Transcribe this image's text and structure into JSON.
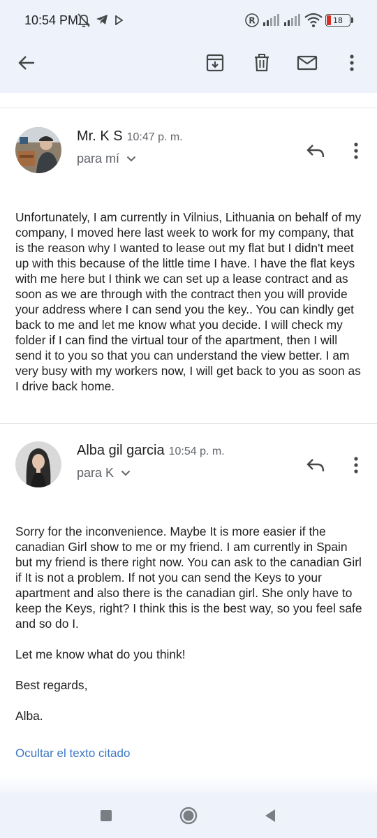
{
  "status_bar": {
    "time": "10:54 PM",
    "battery": "18",
    "icons": [
      "bell-off-icon",
      "telegram-icon",
      "play-icon",
      "registered-icon",
      "signal-icon",
      "wifi-icon",
      "battery-icon"
    ]
  },
  "toolbar": {
    "back": "arrow-back-icon",
    "actions": [
      "archive-icon",
      "delete-icon",
      "mark-unread-icon",
      "more-vert-icon"
    ]
  },
  "thread": {
    "messages": [
      {
        "sender": "Mr. K S",
        "time": "10:47 p. m.",
        "recipient": "para mí",
        "body": [
          "Unfortunately, I am currently in Vilnius, Lithuania on behalf of my company, I moved here last week to work for my company, that is the reason why I wanted to lease out my flat but I didn't meet up with this because of the little time I have. I have the flat keys with me here but I think we can set up a lease contract and as soon as we are through with the contract then you will provide your address where I can send you the key.. You can kindly get back to me and let me know what you decide. I will check my folder if I can find the virtual tour of the apartment, then I will send it to you so that you can understand the view better. I am very busy with my workers now, I will get back to you as soon as I drive back home."
        ]
      },
      {
        "sender": "Alba gil garcia",
        "time": "10:54 p. m.",
        "recipient": "para K",
        "body": [
          "Sorry for the inconvenience. Maybe It is more easier if the canadian Girl show to me or my friend. I am currently in Spain but my friend is there right now. You can ask to the canadian Girl if It is not a problem. If not you can send the Keys to your apartment and also there is the canadian girl. She only have to keep the Keys, right? I think this is the best way, so you feel safe and so do I.",
          "Let me know what do you think!",
          "Best regards,",
          "Alba."
        ]
      }
    ],
    "quoted_text_link": "Ocultar el texto citado"
  },
  "nav_bar": {
    "buttons": [
      "recents-icon",
      "home-icon",
      "back-icon"
    ]
  },
  "colors": {
    "header_bg": "#eef2fa",
    "link": "#3b78c3",
    "icon": "#444746",
    "secondary_text": "#5f6368"
  }
}
